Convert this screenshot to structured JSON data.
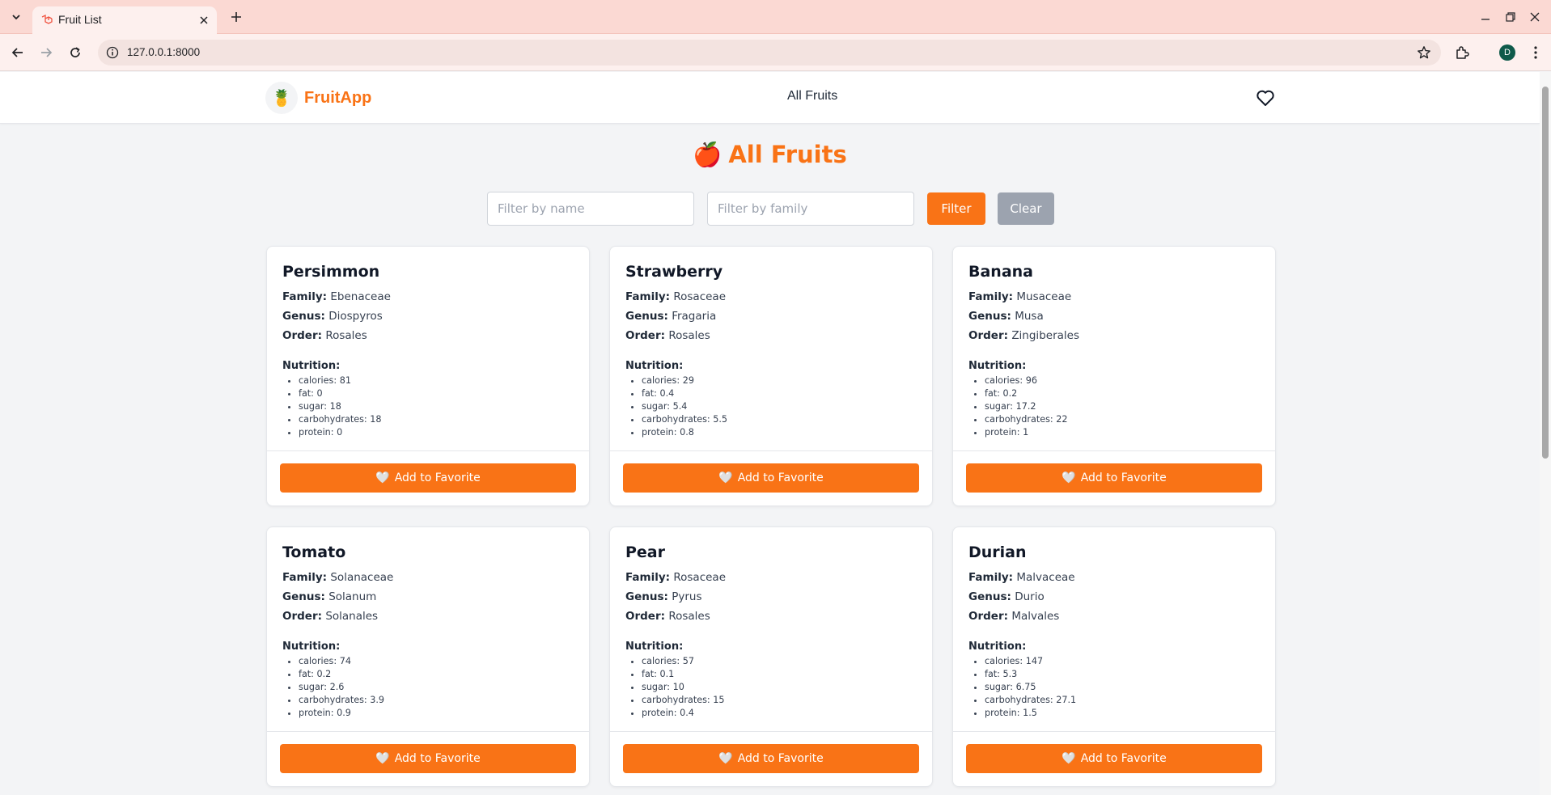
{
  "browser": {
    "tab_title": "Fruit List",
    "url": "127.0.0.1:8000",
    "profile_initial": "D"
  },
  "header": {
    "brand": "FruitApp",
    "brand_icon": "🍍",
    "nav_all": "All Fruits",
    "favorites_icon": "heart-outline-icon"
  },
  "page": {
    "title_emoji": "🍎",
    "title": "All Fruits"
  },
  "filters": {
    "name_placeholder": "Filter by name",
    "family_placeholder": "Filter by family",
    "name_value": "",
    "family_value": "",
    "filter_label": "Filter",
    "clear_label": "Clear"
  },
  "labels": {
    "family": "Family:",
    "genus": "Genus:",
    "order": "Order:",
    "nutrition": "Nutrition:",
    "add_favorite": "Add to Favorite",
    "heart": "🤍"
  },
  "fruits": [
    {
      "name": "Persimmon",
      "family": "Ebenaceae",
      "genus": "Diospyros",
      "order": "Rosales",
      "nutrition": [
        "calories: 81",
        "fat: 0",
        "sugar: 18",
        "carbohydrates: 18",
        "protein: 0"
      ]
    },
    {
      "name": "Strawberry",
      "family": "Rosaceae",
      "genus": "Fragaria",
      "order": "Rosales",
      "nutrition": [
        "calories: 29",
        "fat: 0.4",
        "sugar: 5.4",
        "carbohydrates: 5.5",
        "protein: 0.8"
      ]
    },
    {
      "name": "Banana",
      "family": "Musaceae",
      "genus": "Musa",
      "order": "Zingiberales",
      "nutrition": [
        "calories: 96",
        "fat: 0.2",
        "sugar: 17.2",
        "carbohydrates: 22",
        "protein: 1"
      ]
    },
    {
      "name": "Tomato",
      "family": "Solanaceae",
      "genus": "Solanum",
      "order": "Solanales",
      "nutrition": [
        "calories: 74",
        "fat: 0.2",
        "sugar: 2.6",
        "carbohydrates: 3.9",
        "protein: 0.9"
      ]
    },
    {
      "name": "Pear",
      "family": "Rosaceae",
      "genus": "Pyrus",
      "order": "Rosales",
      "nutrition": [
        "calories: 57",
        "fat: 0.1",
        "sugar: 10",
        "carbohydrates: 15",
        "protein: 0.4"
      ]
    },
    {
      "name": "Durian",
      "family": "Malvaceae",
      "genus": "Durio",
      "order": "Malvales",
      "nutrition": [
        "calories: 147",
        "fat: 5.3",
        "sugar: 6.75",
        "carbohydrates: 27.1",
        "protein: 1.5"
      ]
    }
  ],
  "colors": {
    "accent": "#f97316",
    "muted_button": "#9ca3af",
    "background": "#f3f4f6",
    "tab_strip": "#fbd9d3"
  }
}
